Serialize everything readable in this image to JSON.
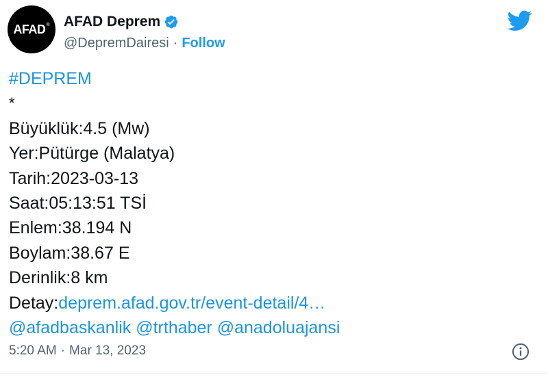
{
  "account": {
    "avatar_text": "AFAD",
    "avatar_mark": "®",
    "display_name": "AFAD Deprem",
    "handle": "@DepremDairesi",
    "separator": "·",
    "follow_label": "Follow",
    "verified_icon": "verified-badge-icon",
    "platform_icon": "twitter-bird-icon"
  },
  "tweet": {
    "hashtag": "#DEPREM",
    "asterisk": "*",
    "magnitude": "Büyüklük:4.5 (Mw)",
    "location": "Yer:Pütürge (Malatya)",
    "date": "Tarih:2023-03-13",
    "time": "Saat:05:13:51 TSİ",
    "latitude": "Enlem:38.194 N",
    "longitude": "Boylam:38.67 E",
    "depth": "Derinlik:8 km",
    "detail_prefix": "Detay:",
    "detail_link": "deprem.afad.gov.tr/event-detail/4…",
    "mention_1": "@afadbaskanlik",
    "mention_2": "@trthaber",
    "mention_3": "@anadoluajansi"
  },
  "meta": {
    "time": "5:20 AM",
    "separator": "·",
    "date": "Mar 13, 2023",
    "info_icon": "info-icon"
  },
  "colors": {
    "link": "#1b95e0",
    "verified": "#1d9bf0",
    "muted": "#536471"
  }
}
